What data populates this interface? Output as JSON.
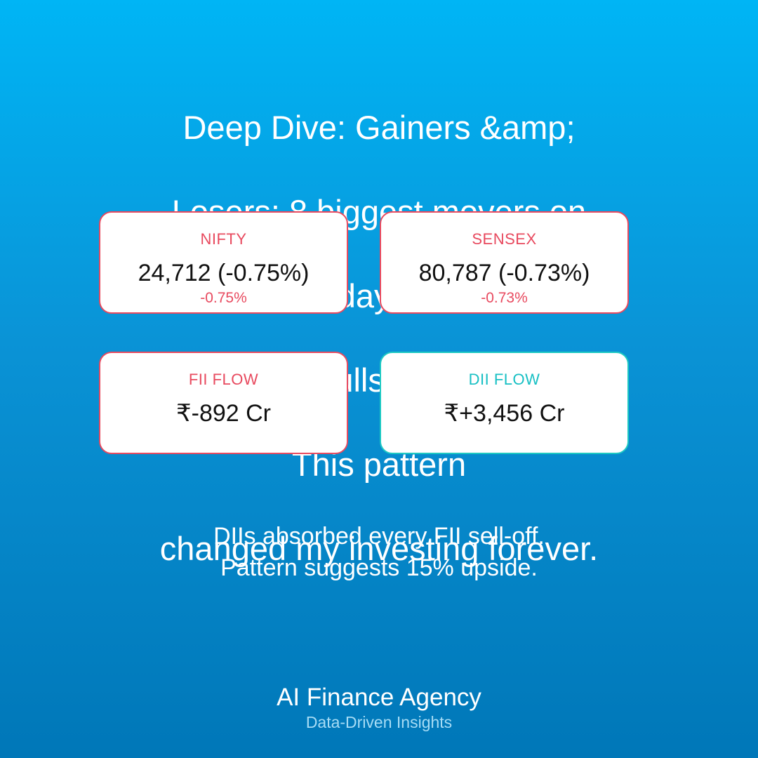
{
  "headline": {
    "line1": "Deep Dive: Gainers &amp;",
    "line2": "Losers: 8 biggest movers on",
    "line3": "D-Street today. Here’s what",
    "line4": "triggered bulls &amp; bears",
    "line5": "This pattern",
    "line6": "changed my investing forever."
  },
  "cards": {
    "nifty": {
      "label": "NIFTY",
      "value": "24,712 (-0.75%)",
      "change": "-0.75%"
    },
    "sensex": {
      "label": "SENSEX",
      "value": "80,787 (-0.73%)",
      "change": "-0.73%"
    },
    "fii": {
      "label": "FII FLOW",
      "value": "₹-892 Cr"
    },
    "dii": {
      "label": "DII FLOW",
      "value": "₹+3,456 Cr"
    }
  },
  "insight": {
    "line1": "DIIs absorbed every FII sell-off.",
    "line2": "Pattern suggests 15% upside."
  },
  "brand": {
    "name": "AI Finance Agency",
    "tagline": "Data-Driven Insights"
  },
  "colors": {
    "background_top": "#00b5f5",
    "background_bottom": "#0077b8",
    "negative": "#e84a5f",
    "positive": "#18c0c4"
  }
}
